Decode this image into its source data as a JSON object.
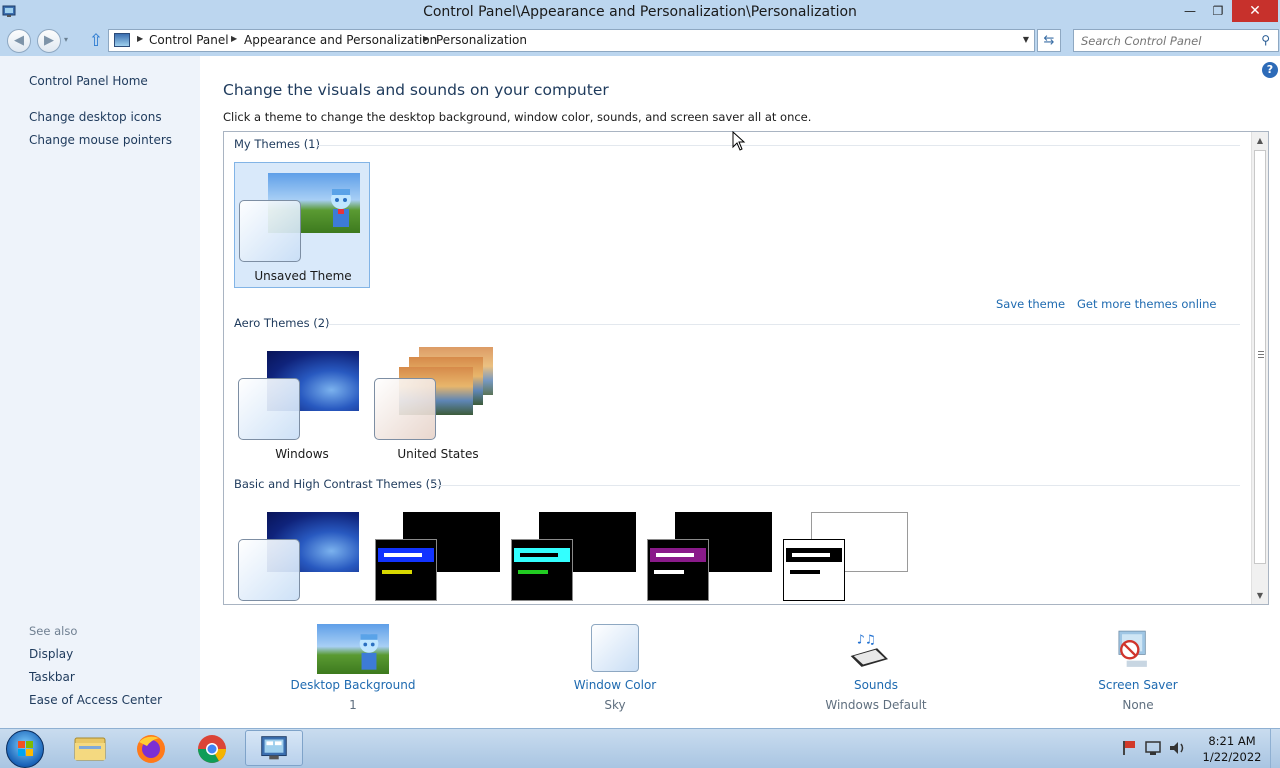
{
  "window": {
    "title": "Control Panel\\Appearance and Personalization\\Personalization",
    "minimize": "—",
    "maximize": "❐",
    "close": "✕"
  },
  "nav": {
    "back_glyph": "◀",
    "forward_glyph": "▶",
    "recent_glyph": "▾",
    "up_glyph": "⇧",
    "breadcrumb": [
      "Control Panel",
      "Appearance and Personalization",
      "Personalization"
    ],
    "crumb_separator": "▶",
    "dropdown_glyph": "▼",
    "refresh_glyph": "⇆",
    "search_placeholder": "Search Control Panel",
    "search_icon": "⚲"
  },
  "sidebar": {
    "home": "Control Panel Home",
    "links": [
      "Change desktop icons",
      "Change mouse pointers"
    ],
    "see_also_title": "See also",
    "see_also": [
      "Display",
      "Taskbar",
      "Ease of Access Center"
    ]
  },
  "main": {
    "help": "?",
    "title": "Change the visuals and sounds on your computer",
    "description": "Click a theme to change the desktop background, window color, sounds, and screen saver all at once.",
    "groups": {
      "my": {
        "title": "My Themes (1)",
        "items": [
          "Unsaved Theme"
        ]
      },
      "aero": {
        "title": "Aero Themes (2)",
        "items": [
          "Windows",
          "United States"
        ]
      },
      "basic": {
        "title": "Basic and High Contrast Themes (5)"
      }
    },
    "save_theme": "Save theme",
    "get_more": "Get more themes online",
    "scroll_up": "▲",
    "scroll_down": "▼"
  },
  "settings": [
    {
      "name": "Desktop Background",
      "value": "1"
    },
    {
      "name": "Window Color",
      "value": "Sky"
    },
    {
      "name": "Sounds",
      "value": "Windows Default"
    },
    {
      "name": "Screen Saver",
      "value": "None"
    }
  ],
  "taskbar": {
    "time": "8:21 AM",
    "date": "1/22/2022",
    "tray_icons": [
      "flag-icon",
      "network-icon",
      "volume-icon"
    ]
  },
  "colors": {
    "titlebar": "#bcd6ef",
    "close_button": "#c7312c",
    "link": "#1e6ab0",
    "heading": "#1e3a5c",
    "selected_theme": "#d9e9fa"
  }
}
